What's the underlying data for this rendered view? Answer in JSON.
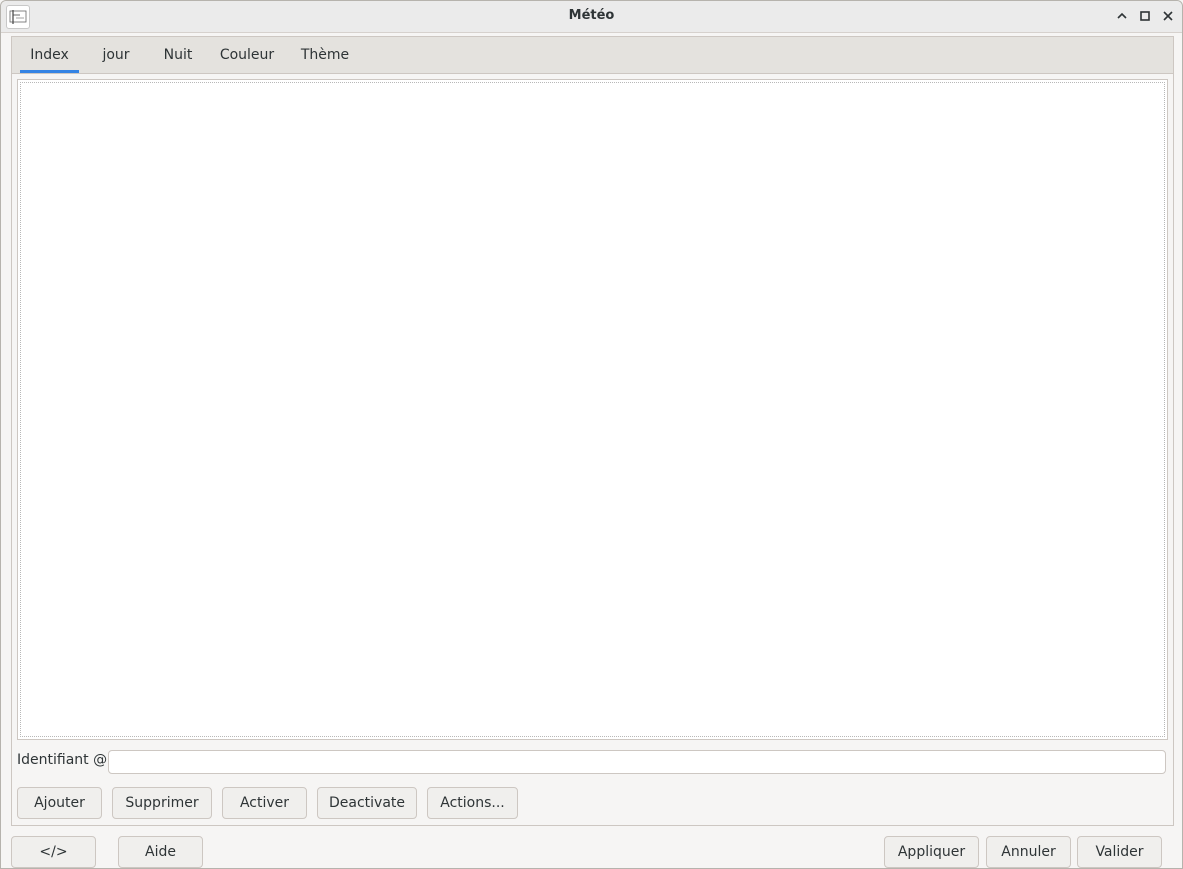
{
  "window": {
    "title": "Météo",
    "icon": "app-logo-icon",
    "controls": [
      "minimize-icon",
      "maximize-icon",
      "close-icon"
    ]
  },
  "tabs": [
    {
      "label": "Index",
      "active": true
    },
    {
      "label": "jour",
      "active": false
    },
    {
      "label": "Nuit",
      "active": false
    },
    {
      "label": "Couleur",
      "active": false
    },
    {
      "label": "Thème",
      "active": false
    }
  ],
  "identifier": {
    "label": "Identifiant @",
    "value": "",
    "placeholder": ""
  },
  "actions": {
    "add": "Ajouter",
    "delete": "Supprimer",
    "activate": "Activer",
    "deactivate": "Deactivate",
    "more": "Actions..."
  },
  "footer": {
    "source": "</>",
    "help": "Aide",
    "apply": "Appliquer",
    "cancel": "Annuler",
    "ok": "Valider"
  },
  "colors": {
    "accent": "#3584e4",
    "background": "#f6f5f4",
    "tabbar": "#e4e2de"
  }
}
